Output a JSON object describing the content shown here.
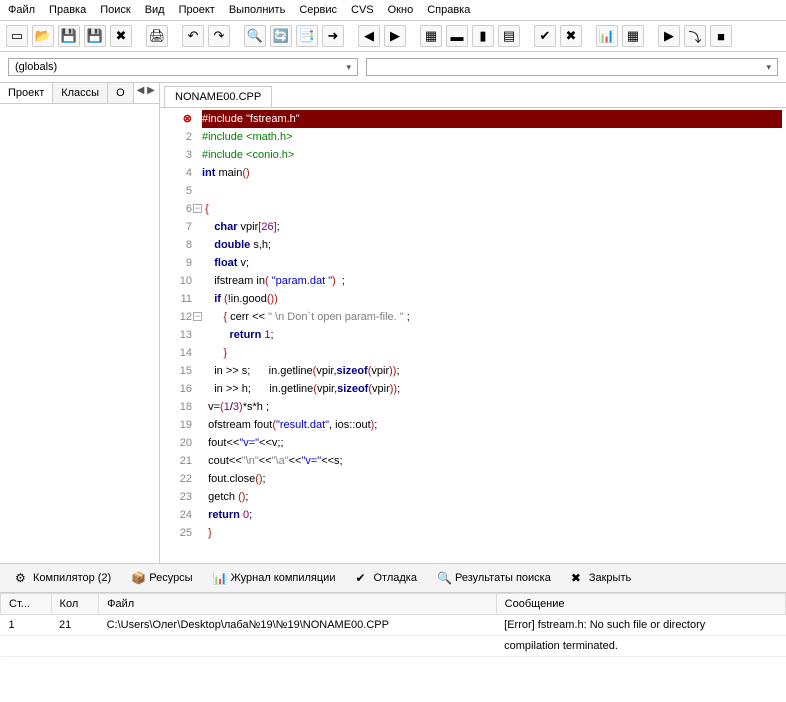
{
  "menu": [
    "Файл",
    "Правка",
    "Поиск",
    "Вид",
    "Проект",
    "Выполнить",
    "Сервис",
    "CVS",
    "Окно",
    "Справка"
  ],
  "toolbar_icons": [
    "file-new",
    "folder-open",
    "save",
    "save-all",
    "close",
    "",
    "print",
    "",
    "undo",
    "redo",
    "",
    "find",
    "replace",
    "find-in-files",
    "goto",
    "",
    "back",
    "forward",
    "",
    "windows",
    "tile-h",
    "tile-v",
    "cascade",
    "",
    "check",
    "cancel",
    "",
    "chart",
    "grid",
    "",
    "run",
    "step",
    "stop"
  ],
  "combo1": "(globals)",
  "combo2": "",
  "side_tabs": [
    "Проект",
    "Классы",
    "О"
  ],
  "file_tab": "NONAME00.CPP",
  "code": [
    {
      "n": 1,
      "err": true,
      "html": "<span class=\"c-green\">#include \"fstream.h\"</span>"
    },
    {
      "n": 2,
      "html": "<span class=\"c-green\">#include &lt;math.h&gt;</span>"
    },
    {
      "n": 3,
      "html": "<span class=\"c-green\">#include &lt;conio.h&gt;</span>"
    },
    {
      "n": 4,
      "html": "<span class=\"c-blue\">int</span> main<span class=\"c-red\">()</span>"
    },
    {
      "n": 5,
      "html": ""
    },
    {
      "n": 6,
      "fold": true,
      "html": " <span class=\"c-red\">{</span>"
    },
    {
      "n": 7,
      "html": "    <span class=\"c-blue\">char</span> vpir<span class=\"c-red\">[</span><span class=\"c-purple\">26</span><span class=\"c-red\">]</span>;"
    },
    {
      "n": 8,
      "html": "    <span class=\"c-blue\">double</span> s,h;"
    },
    {
      "n": 9,
      "html": "    <span class=\"c-blue\">float</span> v;"
    },
    {
      "n": 10,
      "html": "    ifstream in<span class=\"c-red\">(</span> <span class=\"c-str\">\"param.dat \"</span><span class=\"c-red\">)</span>  ;"
    },
    {
      "n": 11,
      "html": "    <span class=\"c-blue\">if</span> <span class=\"c-red\">(</span>!in.good<span class=\"c-red\">())</span>"
    },
    {
      "n": 12,
      "fold": true,
      "html": "       <span class=\"c-red\">{</span> cerr &lt;&lt; <span class=\"c-strg\">\" \\n Don`t open param-file. \"</span> ;"
    },
    {
      "n": 13,
      "html": "         <span class=\"c-blue\">return</span> <span class=\"c-purple\">1</span>;"
    },
    {
      "n": 14,
      "html": "       <span class=\"c-red\">}</span>"
    },
    {
      "n": 15,
      "html": "    in &gt;&gt; s;      in.getline<span class=\"c-red\">(</span>vpir,<span class=\"c-blue\">sizeof</span><span class=\"c-red\">(</span>vpir<span class=\"c-red\">))</span>;"
    },
    {
      "n": 16,
      "html": "    in &gt;&gt; h;      in.getline<span class=\"c-red\">(</span>vpir,<span class=\"c-blue\">sizeof</span><span class=\"c-red\">(</span>vpir<span class=\"c-red\">))</span>;"
    },
    {
      "n": 18,
      "html": "  v=<span class=\"c-red\">(</span><span class=\"c-purple\">1</span>/<span class=\"c-purple\">3</span><span class=\"c-red\">)</span>*s*h ;"
    },
    {
      "n": 19,
      "html": "  ofstream fout<span class=\"c-red\">(</span><span class=\"c-str\">\"result.dat\"</span>, ios::out<span class=\"c-red\">)</span>;"
    },
    {
      "n": 20,
      "html": "  fout&lt;&lt;<span class=\"c-str\">\"v=\"</span>&lt;&lt;v;;"
    },
    {
      "n": 21,
      "html": "  cout&lt;&lt;<span class=\"c-strg\">\"\\n\"</span>&lt;&lt;<span class=\"c-strg\">\"\\a\"</span>&lt;&lt;<span class=\"c-str\">\"v=\"</span>&lt;&lt;s;"
    },
    {
      "n": 22,
      "html": "  fout.close<span class=\"c-red\">()</span>;"
    },
    {
      "n": 23,
      "html": "  getch <span class=\"c-red\">()</span>;"
    },
    {
      "n": 24,
      "html": "  <span class=\"c-blue\">return</span> <span class=\"c-purple\">0</span>;"
    },
    {
      "n": 25,
      "html": "  <span class=\"c-red\">}</span>"
    }
  ],
  "bottom_tabs": [
    {
      "icon": "⚙",
      "label": "Компилятор (2)"
    },
    {
      "icon": "📦",
      "label": "Ресурсы"
    },
    {
      "icon": "📊",
      "label": "Журнал компиляции"
    },
    {
      "icon": "✔",
      "label": "Отладка"
    },
    {
      "icon": "🔍",
      "label": "Результаты поиска"
    },
    {
      "icon": "✖",
      "label": "Закрыть"
    }
  ],
  "msg_headers": [
    "Ст...",
    "Кол",
    "Файл",
    "Сообщение"
  ],
  "messages": [
    {
      "line": "1",
      "col": "21",
      "file": "C:\\Users\\Олег\\Desktop\\лаба№19\\№19\\NONAME00.CPP",
      "msg": "[Error] fstream.h: No such file or directory"
    },
    {
      "line": "",
      "col": "",
      "file": "",
      "msg": "compilation terminated."
    }
  ]
}
